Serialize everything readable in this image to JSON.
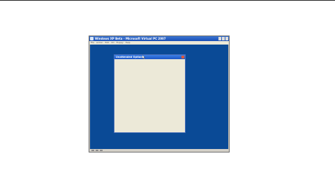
{
  "vpc_window": {
    "title": "Windows XP Beta - Microsoft Virtual PC 2007",
    "menu": [
      "File",
      "Action",
      "Edit",
      "CD",
      "Floppy",
      "Help"
    ]
  },
  "dialog": {
    "title": "Unattended Options"
  },
  "watermark": {
    "line1": "",
    "line2": ""
  },
  "colors": {
    "desktop": "#0a4a96",
    "titlebar": "#1a4fb5",
    "dialog_face": "#ece9d8"
  }
}
